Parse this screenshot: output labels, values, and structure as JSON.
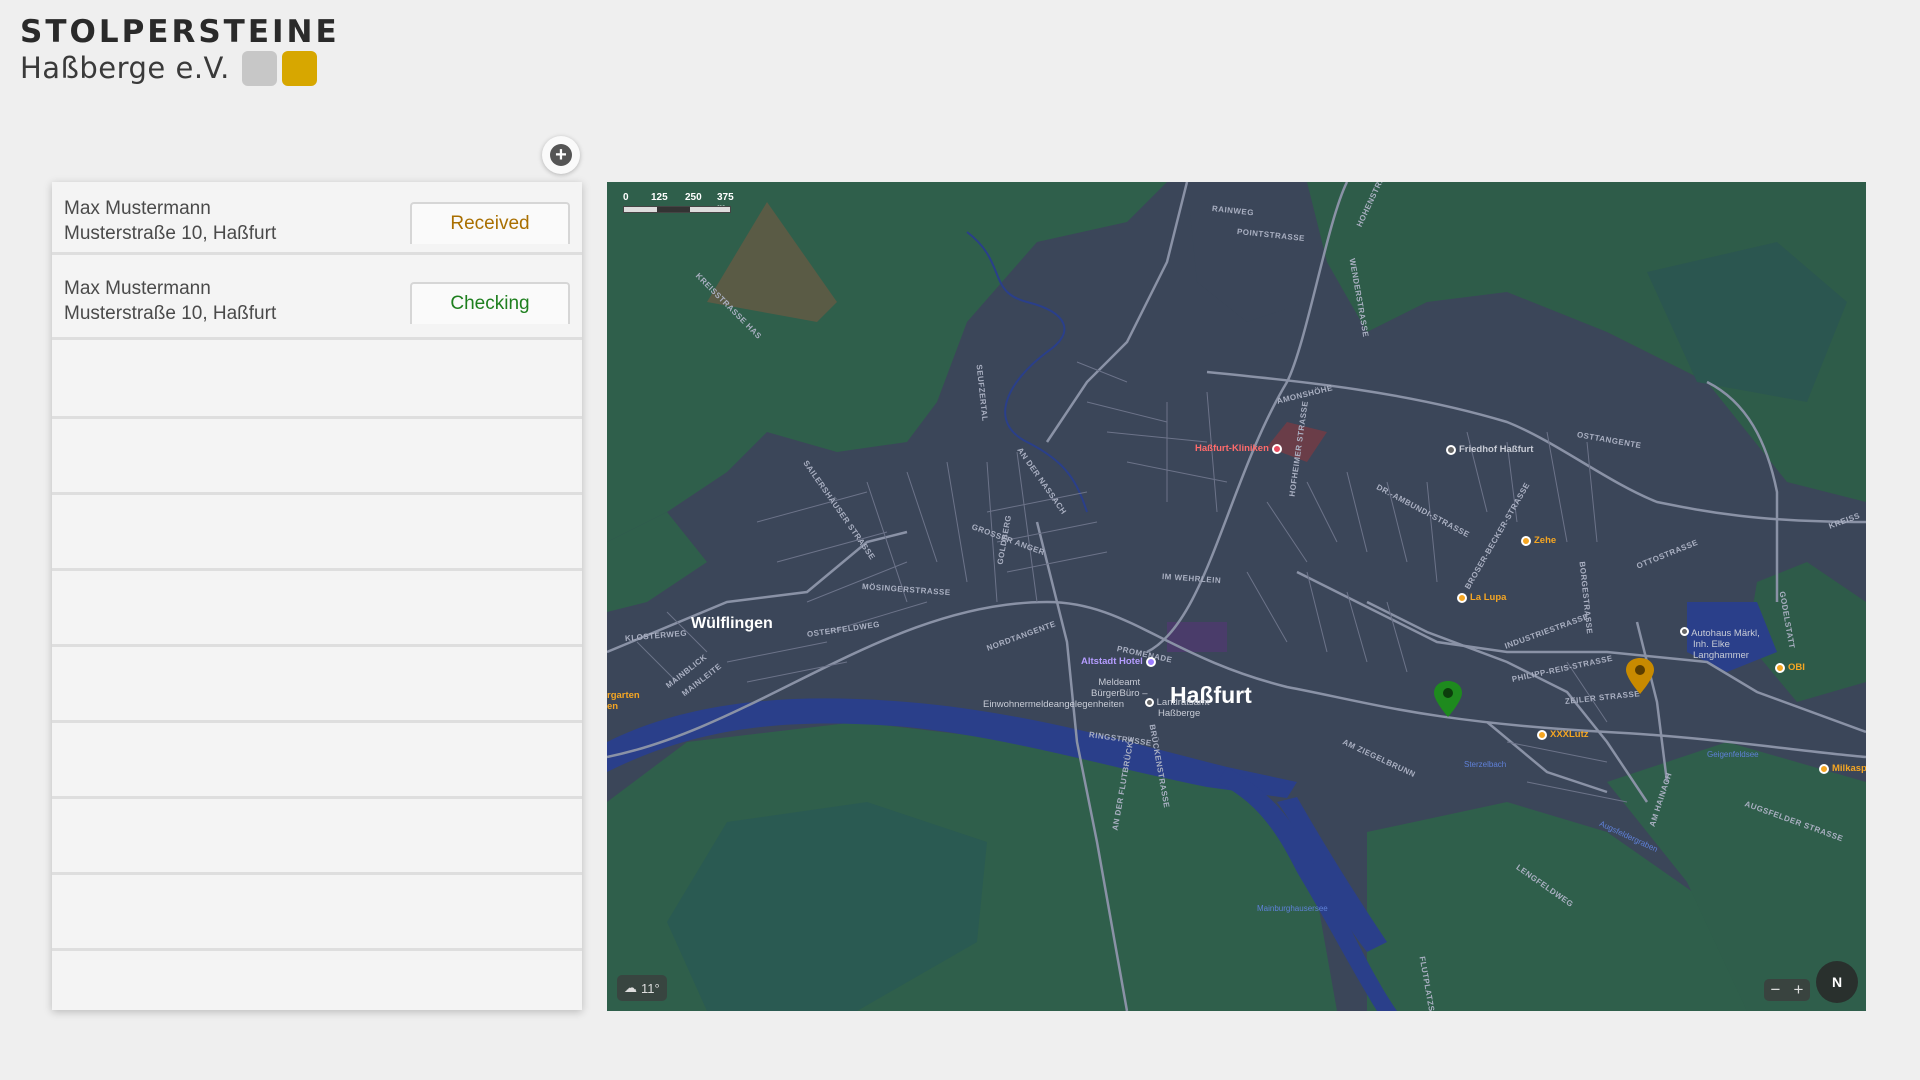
{
  "logo": {
    "title": "STOLPERSTEINE",
    "subtitle": "Haßberge e.V.",
    "square_colors": [
      "#c7c7c7",
      "#d7a700"
    ]
  },
  "add_button": {
    "icon": "plus-icon"
  },
  "entries": [
    {
      "name": "Max Mustermann",
      "address": "Musterstraße 10, Haßfurt",
      "status": "Received",
      "status_color": "#a96f00"
    },
    {
      "name": "Max Mustermann",
      "address": "Musterstraße 10, Haßfurt",
      "status": "Checking",
      "status_color": "#1e7f1e"
    }
  ],
  "map": {
    "scale": {
      "ticks": [
        "0",
        "125",
        "250",
        "375 m"
      ]
    },
    "weather": {
      "icon": "cloud-rain-icon",
      "temp": "11°"
    },
    "zoom": {
      "minus": "−",
      "plus": "+"
    },
    "compass": "N",
    "towns": {
      "main": "Haßfurt",
      "west": "Wülflingen"
    },
    "streets": [
      "RAINWEG",
      "POINTSTRASSE",
      "HOHENSTRASSE",
      "WENDERSTRASSE",
      "KREISSTRASSE HAS",
      "AMONSHÖHE",
      "OSTTANGENTE",
      "SEUFZERTAL",
      "AN DER NASSACH",
      "HOFHEIMER STRASSE",
      "DR.-AMBUNDI-STRASSE",
      "SAILERSHÄUSER STRASSE",
      "GROSSER ANGER",
      "GOLDBERG",
      "IM WEHRLEIN",
      "MÖSINGERSTRASSE",
      "NORDTANGENTE",
      "PROMENADE",
      "OSTERFELDWEG",
      "KLOSTERWEG",
      "MAINBLICK",
      "MAINLEITE",
      "RINGSTRASSE",
      "BRÜCKENSTRASSE",
      "AN DER FLUTBRÜCKE",
      "AM ZIEGELBRUNN",
      "ZEILER STRASSE",
      "PHILIPP-REIS-STRASSE",
      "INDUSTRIESTRASSE",
      "BROSER-BECKER-STRASSE",
      "OTTOSTRASSE",
      "BORGESTRASSE",
      "GODELSTATT",
      "AUGSFELDER STRASSE",
      "AM HAINACH",
      "LENGFELDWEG",
      "FLUTPLATZSTRASSE",
      "KREISS"
    ],
    "pois": {
      "hospital": "Haßfurt-Kliniken",
      "cemetery": "Friedhof Haßfurt",
      "zehe": "Zehe",
      "lalupa": "La Lupa",
      "hotel": "Altstadt Hotel",
      "meldeamt_1": "Meldeamt",
      "meldeamt_2": "BürgerBüro –",
      "meldeamt_3": "Einwohnermeldeangelegenheiten",
      "landrat_1": "Landratsamt",
      "landrat_2": "Haßberge",
      "xxxlutz": "XXXLutz",
      "autohaus_1": "Autohaus Märkl,",
      "autohaus_2": "Inh. Elke",
      "autohaus_3": "Langhammer",
      "obi": "OBI",
      "milka": "Milkasp",
      "garten_1": "rgarten",
      "garten_2": "en"
    },
    "water": {
      "stream": "Sterzelbach",
      "lake": "Geigenfeldsee",
      "main_lake": "Mainburghausersee",
      "ditch": "Augsfeldergraben"
    },
    "pins": [
      {
        "color": "#1e8a1e",
        "status": "Checking"
      },
      {
        "color": "#c88a00",
        "status": "Received"
      }
    ]
  }
}
